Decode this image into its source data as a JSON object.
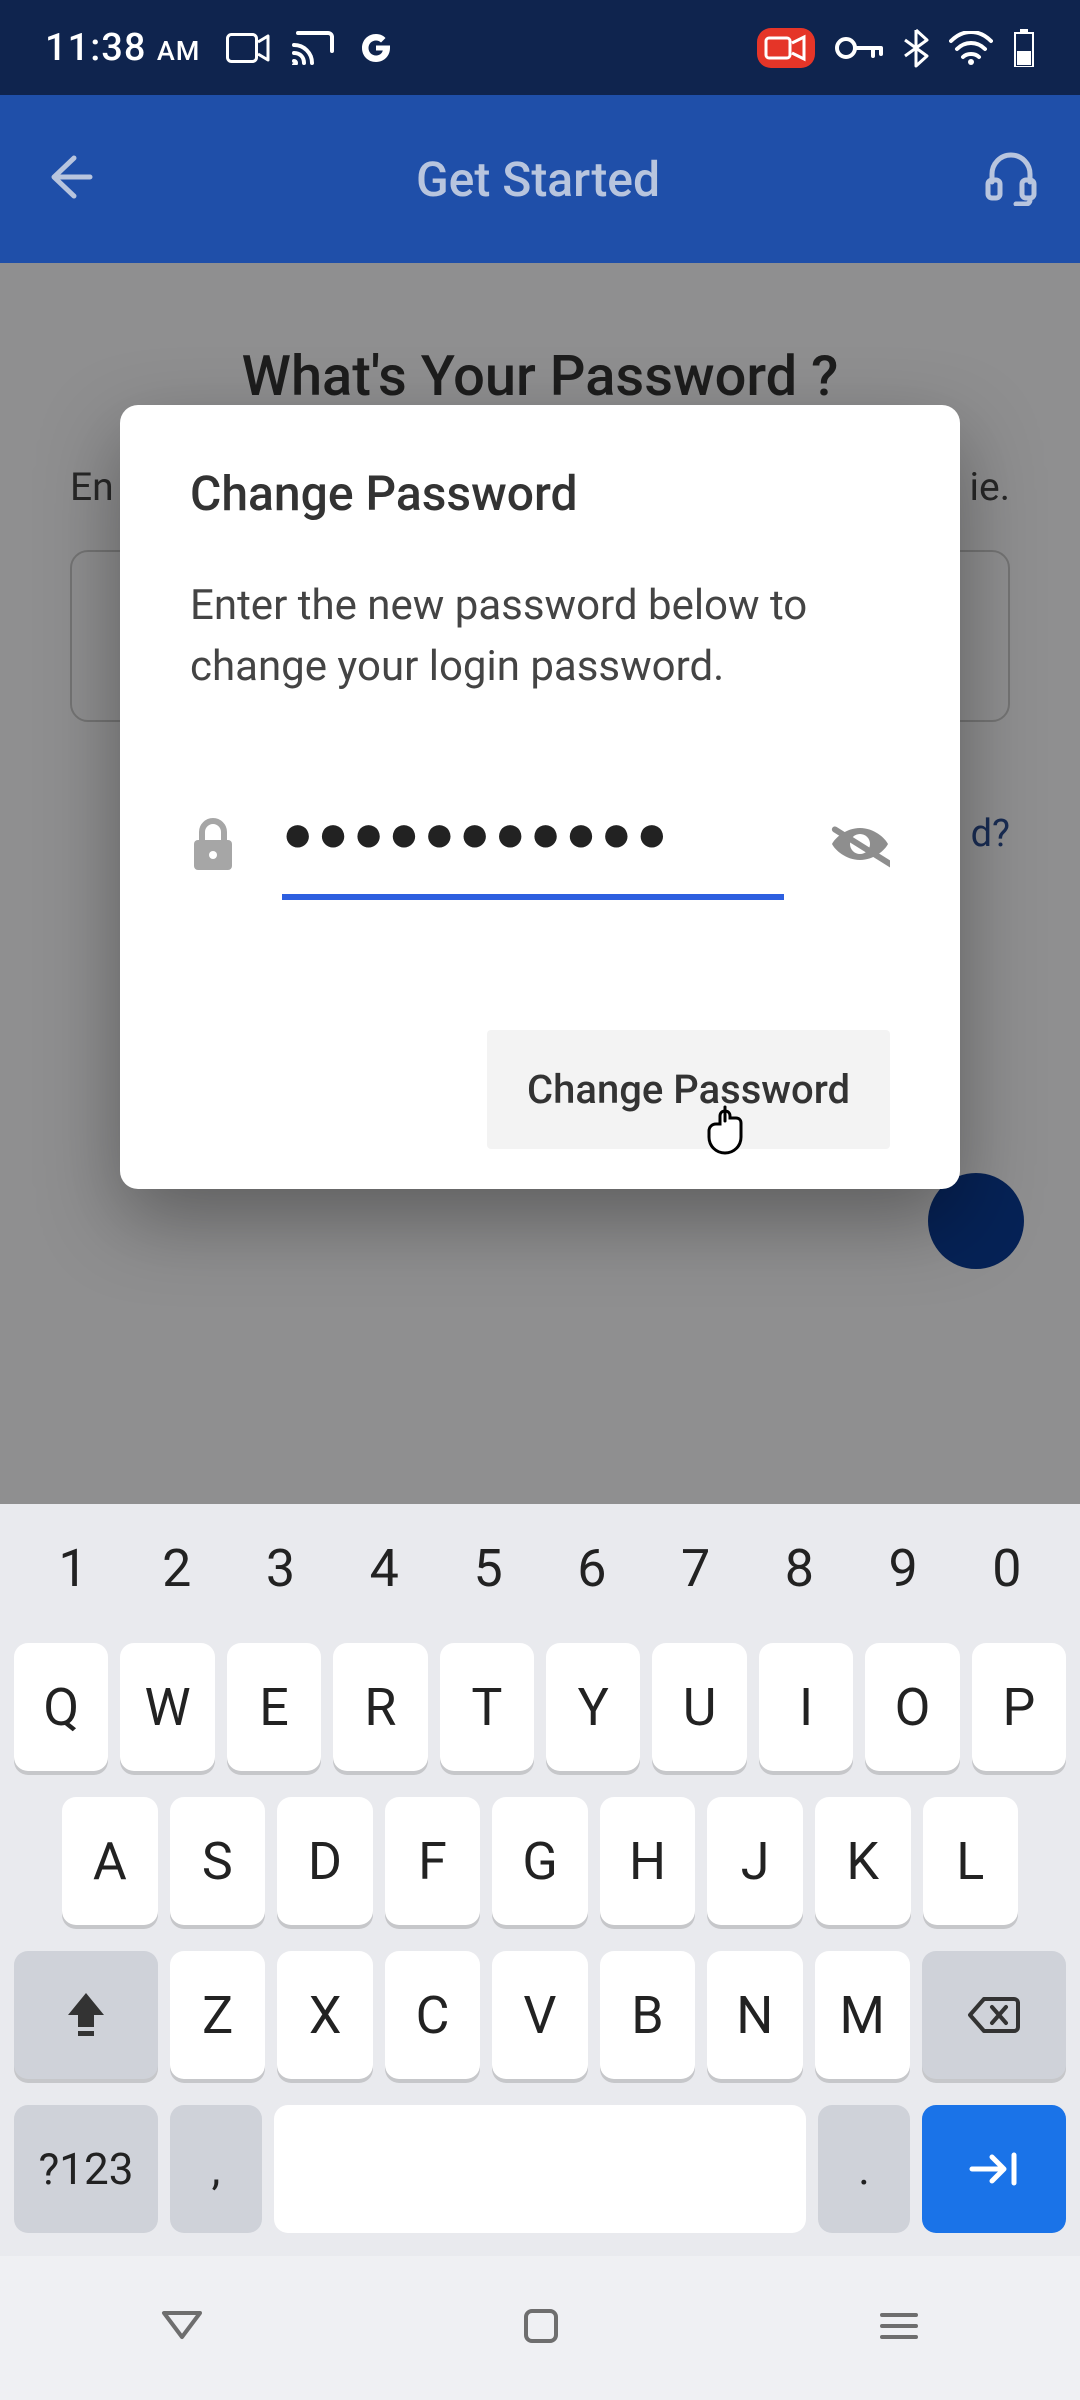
{
  "status": {
    "time": "11:38",
    "ampm": "AM"
  },
  "header": {
    "title": "Get Started"
  },
  "page": {
    "title": "What's Your Password ?",
    "subtitle_left": "En",
    "subtitle_right": "ie.",
    "forgot_right": "d?"
  },
  "dialog": {
    "title": "Change Password",
    "body": "Enter the new password below to change your login password.",
    "password_value": "●●●●●●●●●●●",
    "action": "Change Password"
  },
  "keyboard": {
    "numbers": [
      "1",
      "2",
      "3",
      "4",
      "5",
      "6",
      "7",
      "8",
      "9",
      "0"
    ],
    "row1": [
      "Q",
      "W",
      "E",
      "R",
      "T",
      "Y",
      "U",
      "I",
      "O",
      "P"
    ],
    "row2": [
      "A",
      "S",
      "D",
      "F",
      "G",
      "H",
      "J",
      "K",
      "L"
    ],
    "row3": [
      "Z",
      "X",
      "C",
      "V",
      "B",
      "N",
      "M"
    ],
    "sym": "?123",
    "comma": ",",
    "dot": "."
  }
}
